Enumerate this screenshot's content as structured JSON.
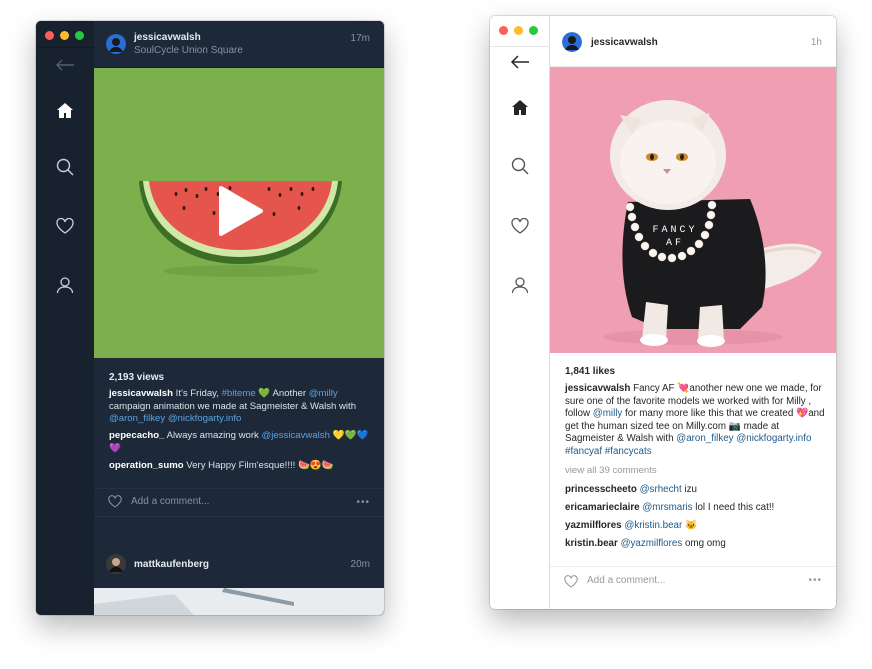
{
  "dark": {
    "nav": {
      "back": "back-arrow",
      "home": "home",
      "search": "search",
      "activity": "heart",
      "profile": "user"
    },
    "post": {
      "username": "jessicavwalsh",
      "location": "SoulCycle Union Square",
      "time": "17m",
      "views": "2,193 views",
      "caption": {
        "user": "jessicavwalsh",
        "t1": " It's Friday, ",
        "tag1": "#biteme",
        "t2": " 💚 Another ",
        "m1": "@milly",
        "t3": " campaign animation we made at Sagmeister & Walsh with ",
        "m2": "@aron_filkey",
        "t4": " ",
        "m3": "@nickfogarty.info"
      },
      "comments": [
        {
          "user": "pepecacho_",
          "t1": " Always amazing work ",
          "mention": "@jessicavwalsh",
          "t2": " 💛💚💙💜"
        },
        {
          "user": "operation_sumo",
          "t1": " Very Happy Film'esque!!!! 🍉😍🍉",
          "mention": "",
          "t2": ""
        }
      ],
      "add_comment_placeholder": "Add a comment...",
      "more": "•••"
    },
    "next_post": {
      "username": "mattkaufenberg",
      "time": "20m"
    }
  },
  "light": {
    "post": {
      "username": "jessicavwalsh",
      "time": "1h",
      "likes": "1,841 likes",
      "caption": {
        "user": "jessicavwalsh",
        "t1": " Fancy AF 💘another new one we made, for sure one of the favorite models we worked with for Milly , follow ",
        "m1": "@milly",
        "t2": " for many more like this that we created 💖and get the human sized tee on Milly.com 📷 made at Sagmeister & Walsh with ",
        "m2": "@aron_filkey",
        "t3": " ",
        "m3": "@nickfogarty.info",
        "t4": " ",
        "tag1": "#fancyaf",
        "t5": " ",
        "tag2": "#fancycats"
      },
      "view_all": "view all 39 comments",
      "comments": [
        {
          "user": "princesscheeto",
          "t1": " ",
          "mention": "@srhecht",
          "t2": " izu"
        },
        {
          "user": "ericamarieclaire",
          "t1": " ",
          "mention": "@mrsmaris",
          "t2": " lol I need this cat!!"
        },
        {
          "user": "yazmilflores",
          "t1": " ",
          "mention": "@kristin.bear",
          "t2": " 🐱"
        },
        {
          "user": "kristin.bear",
          "t1": " ",
          "mention": "@yazmilflores",
          "t2": " omg omg"
        }
      ],
      "add_comment_placeholder": "Add a comment...",
      "more": "•••"
    },
    "shirt_text_1": "FANCY",
    "shirt_text_2": "AF"
  },
  "colors": {
    "dark_bg": "#1d2938",
    "dark_sidebar": "#18222f",
    "link_dark": "#5aa3e0",
    "link_light": "#1f5a8a",
    "green_photo": "#7bb04c",
    "pink_photo": "#f09eb2"
  }
}
